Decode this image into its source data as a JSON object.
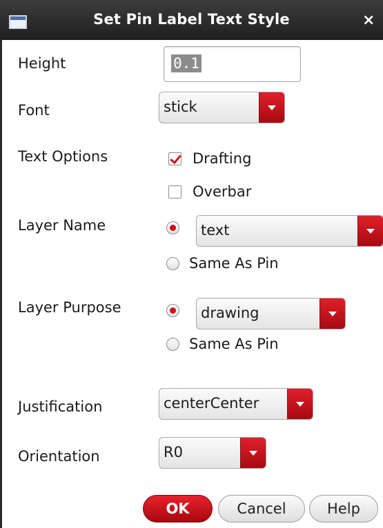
{
  "window": {
    "title": "Set Pin Label Text Style",
    "close_glyph": "×"
  },
  "fields": {
    "height": {
      "label": "Height",
      "value": "0.1"
    },
    "font": {
      "label": "Font",
      "value": "stick"
    },
    "text_options": {
      "label": "Text Options",
      "drafting": {
        "label": "Drafting",
        "checked": true
      },
      "overbar": {
        "label": "Overbar",
        "checked": false
      }
    },
    "layer_name": {
      "label": "Layer Name",
      "selected_value": "text",
      "same_as_pin_label": "Same As Pin",
      "selected_option": "list"
    },
    "layer_purpose": {
      "label": "Layer Purpose",
      "selected_value": "drawing",
      "same_as_pin_label": "Same As Pin",
      "selected_option": "list"
    },
    "justification": {
      "label": "Justification",
      "value": "centerCenter"
    },
    "orientation": {
      "label": "Orientation",
      "value": "R0"
    }
  },
  "buttons": {
    "ok": "OK",
    "cancel": "Cancel",
    "help": "Help"
  },
  "colors": {
    "accent": "#d0101a",
    "titlebar": "#2a2a2a"
  },
  "icons": [
    "window-menu-icon",
    "close-icon",
    "dropdown-arrow-icon",
    "checkmark-icon"
  ]
}
